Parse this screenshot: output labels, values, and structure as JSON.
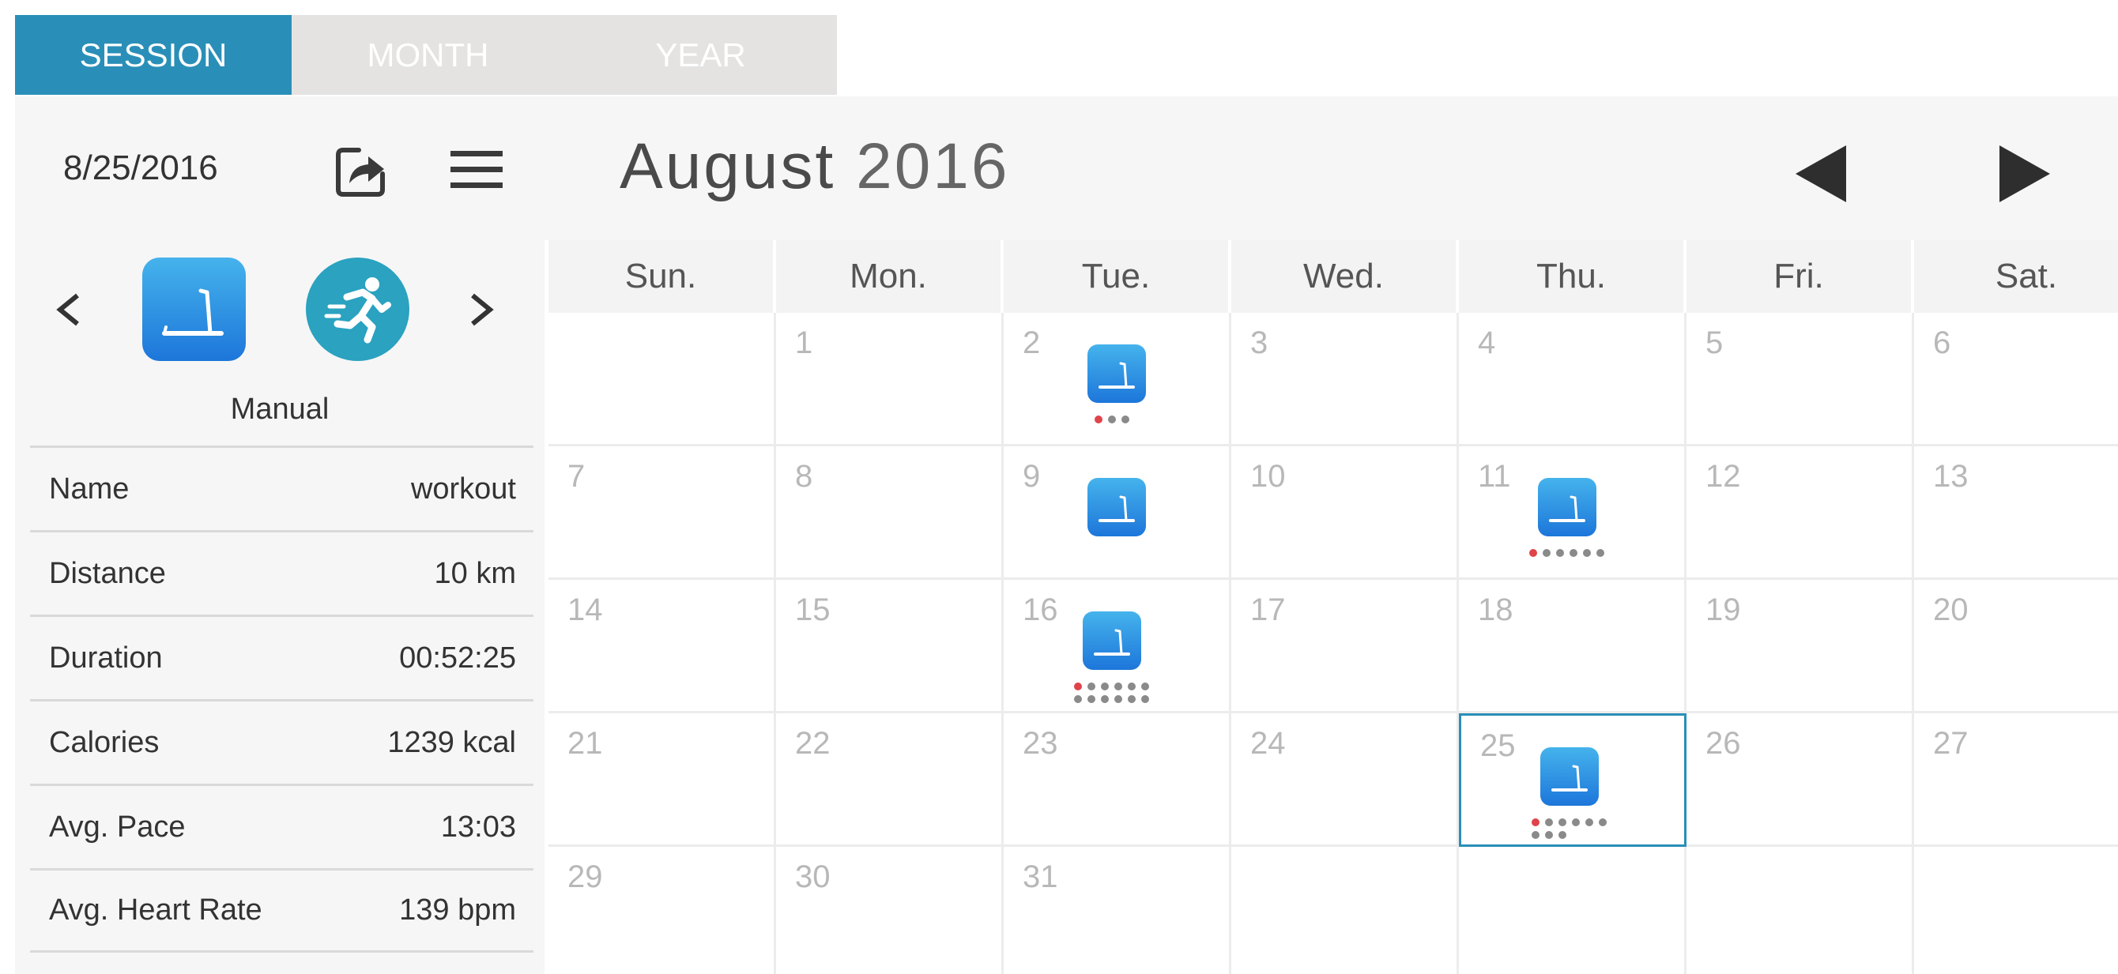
{
  "tabs": [
    {
      "label": "SESSION",
      "active": true
    },
    {
      "label": "MONTH",
      "active": false
    },
    {
      "label": "YEAR",
      "active": false
    }
  ],
  "header": {
    "date": "8/25/2016",
    "month": "August",
    "year": "2016",
    "share_icon": "share-icon",
    "menu_icon": "menu-icon",
    "prev_icon": "triangle-left-icon",
    "next_icon": "triangle-right-icon"
  },
  "session": {
    "mode_label": "Manual",
    "stats": [
      {
        "label": "Name",
        "value": "workout"
      },
      {
        "label": "Distance",
        "value": "10 km"
      },
      {
        "label": "Duration",
        "value": "00:52:25"
      },
      {
        "label": "Calories",
        "value": "1239 kcal"
      },
      {
        "label": "Avg. Pace",
        "value": "13:03"
      },
      {
        "label": "Avg. Heart Rate",
        "value": "139 bpm"
      }
    ]
  },
  "calendar": {
    "weekdays": [
      "Sun.",
      "Mon.",
      "Tue.",
      "Wed.",
      "Thu.",
      "Fri.",
      "Sat."
    ],
    "weeks": [
      [
        "",
        "1",
        "2",
        "3",
        "4",
        "5",
        "6"
      ],
      [
        "7",
        "8",
        "9",
        "10",
        "11",
        "12",
        "13"
      ],
      [
        "14",
        "15",
        "16",
        "17",
        "18",
        "19",
        "20"
      ],
      [
        "21",
        "22",
        "23",
        "24",
        "25",
        "26",
        "27"
      ],
      [
        "29",
        "30",
        "31",
        "",
        "",
        "",
        ""
      ]
    ],
    "selected_day": "25",
    "workouts": [
      {
        "day": "2",
        "sessions": 3
      },
      {
        "day": "9",
        "sessions": 1
      },
      {
        "day": "11",
        "sessions": 6
      },
      {
        "day": "16",
        "sessions": 12
      },
      {
        "day": "25",
        "sessions": 9
      }
    ]
  },
  "colors": {
    "accent": "#2a8fb8",
    "icon_top": "#45b3ec",
    "icon_bottom": "#1d76da",
    "dot_active": "#e0434a",
    "dot": "#8a8a8a"
  }
}
